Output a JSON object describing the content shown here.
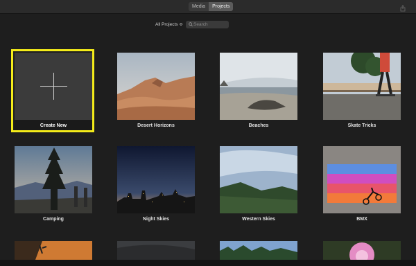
{
  "toolbar": {
    "tabs": [
      {
        "label": "Media",
        "active": false
      },
      {
        "label": "Projects",
        "active": true
      }
    ]
  },
  "filter": {
    "dropdown_label": "All Projects ≎",
    "search_placeholder": "Search"
  },
  "projects": {
    "create_label": "Create New",
    "items": [
      {
        "label": "Desert Horizons"
      },
      {
        "label": "Beaches"
      },
      {
        "label": "Skate Tricks"
      },
      {
        "label": "Camping"
      },
      {
        "label": "Night Skies"
      },
      {
        "label": "Western Skies"
      },
      {
        "label": "BMX"
      }
    ]
  },
  "colors": {
    "background": "#1e1e1e",
    "selection": "#f4ec1a"
  }
}
